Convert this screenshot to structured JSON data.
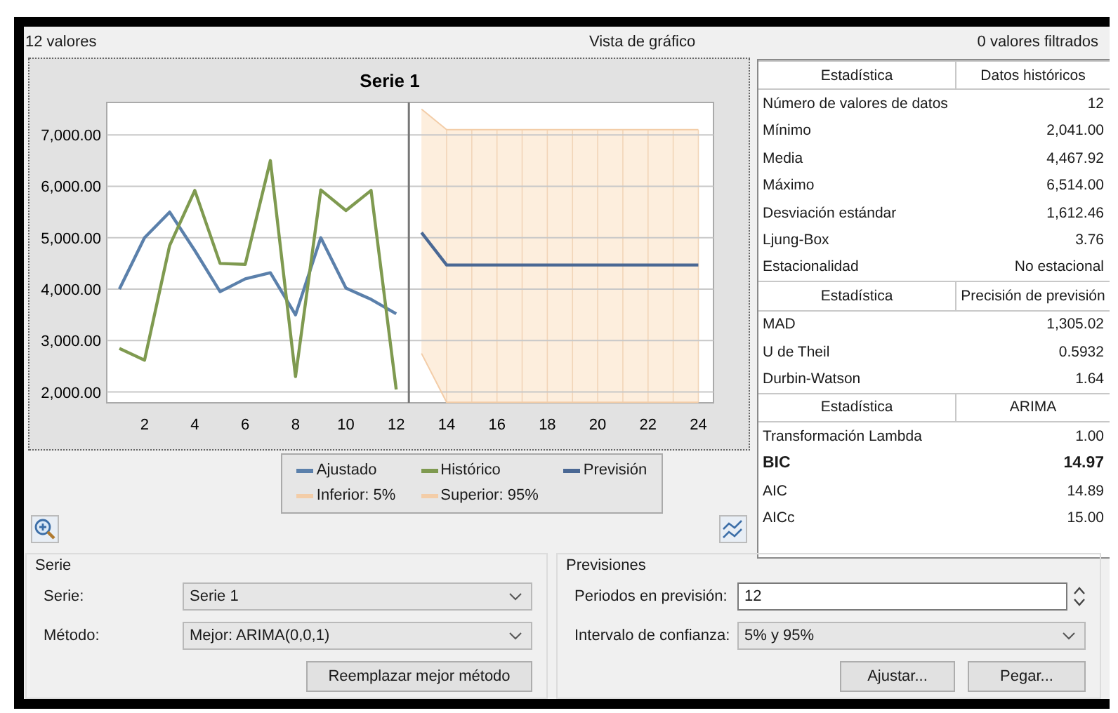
{
  "header": {
    "count": "12 valores",
    "title": "Vista de gráfico",
    "filtered": "0 valores filtrados"
  },
  "chart": {
    "chart_data": {
      "type": "line",
      "title": "Serie 1",
      "x": [
        1,
        2,
        3,
        4,
        5,
        6,
        7,
        8,
        9,
        10,
        11,
        12,
        13,
        14,
        15,
        16,
        17,
        18,
        19,
        20,
        21,
        22,
        23,
        24
      ],
      "series": [
        {
          "name": "Ajustado",
          "color": "#5b80ab",
          "values": [
            4000,
            5000,
            5500,
            4750,
            3950,
            4200,
            4320,
            3500,
            5000,
            4020,
            3800,
            3520,
            null,
            null,
            null,
            null,
            null,
            null,
            null,
            null,
            null,
            null,
            null,
            null
          ]
        },
        {
          "name": "Histórico",
          "color": "#7f9a50",
          "values": [
            2850,
            2620,
            4850,
            5920,
            4500,
            4480,
            6500,
            2300,
            5930,
            5530,
            5920,
            2050,
            null,
            null,
            null,
            null,
            null,
            null,
            null,
            null,
            null,
            null,
            null,
            null
          ]
        },
        {
          "name": "Previsión",
          "color": "#4a6894",
          "values": [
            null,
            null,
            null,
            null,
            null,
            null,
            null,
            null,
            null,
            null,
            null,
            null,
            5100,
            4470,
            4470,
            4470,
            4470,
            4470,
            4470,
            4470,
            4470,
            4470,
            4470,
            4470
          ]
        },
        {
          "name": "Inferior: 5%",
          "color": "#f3cda8",
          "values": [
            null,
            null,
            null,
            null,
            null,
            null,
            null,
            null,
            null,
            null,
            null,
            null,
            2750,
            1800,
            1800,
            1800,
            1800,
            1800,
            1800,
            1800,
            1800,
            1800,
            1800,
            1800
          ]
        },
        {
          "name": "Superior: 95%",
          "color": "#f3cda8",
          "values": [
            null,
            null,
            null,
            null,
            null,
            null,
            null,
            null,
            null,
            null,
            null,
            null,
            7500,
            7100,
            7100,
            7100,
            7100,
            7100,
            7100,
            7100,
            7100,
            7100,
            7100,
            7100
          ]
        }
      ],
      "xlim": [
        0.5,
        24.6
      ],
      "ylim": [
        1790,
        7630
      ],
      "grid": true,
      "bands": [
        {
          "axis": "x",
          "from": 13,
          "to": 24,
          "color": "#fdeedd"
        }
      ],
      "ref_lines": [
        {
          "axis": "x",
          "value": 12.5,
          "color": "#777777"
        }
      ],
      "xticks": [
        2,
        4,
        6,
        8,
        10,
        12,
        14,
        16,
        18,
        20,
        22,
        24
      ],
      "yticks": [
        {
          "value": 2000,
          "label": "2,000.00"
        },
        {
          "value": 3000,
          "label": "3,000.00"
        },
        {
          "value": 4000,
          "label": "4,000.00"
        },
        {
          "value": 5000,
          "label": "5,000.00"
        },
        {
          "value": 6000,
          "label": "6,000.00"
        },
        {
          "value": 7000,
          "label": "7,000.00"
        }
      ]
    }
  },
  "stats": [
    {
      "columns": [
        "Estadística",
        "Datos históricos"
      ],
      "rows": [
        {
          "label": "Número de valores de datos",
          "value": "12",
          "bold": false
        },
        {
          "label": "Mínimo",
          "value": "2,041.00",
          "bold": false
        },
        {
          "label": "Media",
          "value": "4,467.92",
          "bold": false
        },
        {
          "label": "Máximo",
          "value": "6,514.00",
          "bold": false
        },
        {
          "label": "Desviación estándar",
          "value": "1,612.46",
          "bold": false
        },
        {
          "label": "Ljung-Box",
          "value": "3.76",
          "bold": false
        },
        {
          "label": "Estacionalidad",
          "value": "No estacional",
          "bold": false
        }
      ]
    },
    {
      "columns": [
        "Estadística",
        "Precisión de previsión"
      ],
      "rows": [
        {
          "label": "MAD",
          "value": "1,305.02",
          "bold": false
        },
        {
          "label": "U de Theil",
          "value": "0.5932",
          "bold": false
        },
        {
          "label": "Durbin-Watson",
          "value": "1.64",
          "bold": false
        }
      ]
    },
    {
      "columns": [
        "Estadística",
        "ARIMA"
      ],
      "rows": [
        {
          "label": "Transformación Lambda",
          "value": "1.00",
          "bold": false
        },
        {
          "label": "BIC",
          "value": "14.97",
          "bold": true
        },
        {
          "label": "AIC",
          "value": "14.89",
          "bold": false
        },
        {
          "label": "AICc",
          "value": "15.00",
          "bold": false
        }
      ]
    }
  ],
  "serie_group": {
    "title": "Serie",
    "fields": [
      {
        "label": "Serie:",
        "kind": "dropdown",
        "value": "Serie 1"
      },
      {
        "label": "Método:",
        "kind": "dropdown",
        "value": "Mejor: ARIMA(0,0,1)"
      }
    ],
    "buttons": [
      "Reemplazar mejor método"
    ]
  },
  "forecast_group": {
    "title": "Previsiones",
    "fields": [
      {
        "label": "Periodos en previsión:",
        "kind": "spinner",
        "value": "12"
      },
      {
        "label": "Intervalo de confianza:",
        "kind": "dropdown",
        "value": "5% y 95%"
      }
    ],
    "buttons": [
      "Ajustar...",
      "Pegar..."
    ]
  }
}
